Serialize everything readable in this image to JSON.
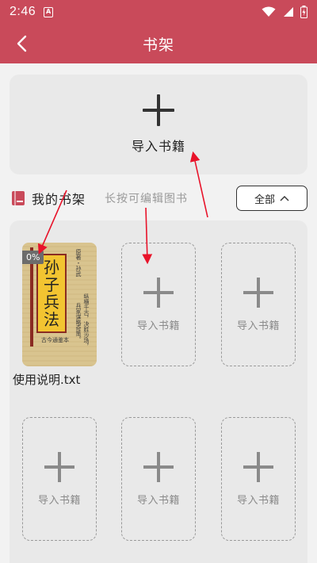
{
  "status_bar": {
    "time": "2:46",
    "notif_glyph": "A"
  },
  "header": {
    "title": "书架",
    "back_icon": "chevron-left-icon"
  },
  "import_card": {
    "label": "导入书籍"
  },
  "shelf_header": {
    "title": "我的书架",
    "hint": "长按可编辑图书",
    "filter_label": "全部"
  },
  "books": [
    {
      "name": "使用说明.txt",
      "progress": "0%",
      "cover_title": [
        "孙",
        "子",
        "兵",
        "法"
      ],
      "cover_sub": "古今通鉴本",
      "cover_author": "原著・孙武",
      "cover_blurb_1": "纵横千古，决胜沙场，",
      "cover_blurb_2": "兵家谋略奇策。"
    }
  ],
  "empty_slot_label": "导入书籍",
  "colors": {
    "brand": "#c94a5a",
    "annotation": "#e8132a"
  }
}
